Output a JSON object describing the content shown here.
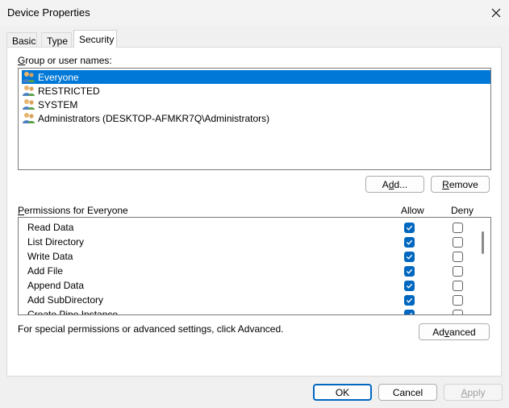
{
  "window": {
    "title": "Device Properties",
    "close_icon": "close-icon"
  },
  "tabs": [
    {
      "label": "Basic",
      "active": false
    },
    {
      "label": "Type",
      "active": false
    },
    {
      "label": "Security",
      "active": true
    }
  ],
  "security": {
    "group_label_hotkey": "G",
    "group_label_rest": "roup or user names:",
    "users": [
      {
        "name": "Everyone",
        "icon": "users-icon",
        "selected": true
      },
      {
        "name": "RESTRICTED",
        "icon": "users-icon",
        "selected": false
      },
      {
        "name": "SYSTEM",
        "icon": "users-icon",
        "selected": false
      },
      {
        "name": "Administrators (DESKTOP-AFMKR7Q\\Administrators)",
        "icon": "users-icon",
        "selected": false
      }
    ],
    "add_button": {
      "pre": "A",
      "hot": "d",
      "post": "d..."
    },
    "remove_button": {
      "pre": "",
      "hot": "R",
      "post": "emove"
    },
    "permissions_label": {
      "hot": "P",
      "rest": "ermissions for Everyone"
    },
    "allow_header": "Allow",
    "deny_header": "Deny",
    "permissions": [
      {
        "name": "Read Data",
        "allow": true,
        "deny": false
      },
      {
        "name": "List Directory",
        "allow": true,
        "deny": false
      },
      {
        "name": "Write Data",
        "allow": true,
        "deny": false
      },
      {
        "name": "Add File",
        "allow": true,
        "deny": false
      },
      {
        "name": "Append Data",
        "allow": true,
        "deny": false
      },
      {
        "name": "Add SubDirectory",
        "allow": true,
        "deny": false
      },
      {
        "name": "Create Pipe Instance",
        "allow": true,
        "deny": false
      }
    ],
    "advanced_text": "For special permissions or advanced settings, click Advanced.",
    "advanced_button": {
      "pre": "Ad",
      "hot": "v",
      "post": "anced"
    }
  },
  "footer": {
    "ok": "OK",
    "cancel": "Cancel",
    "apply": {
      "hot": "A",
      "rest": "pply"
    }
  },
  "colors": {
    "selection": "#0078d7",
    "checkbox_on": "#0067c0",
    "primary_border": "#0067c0"
  }
}
